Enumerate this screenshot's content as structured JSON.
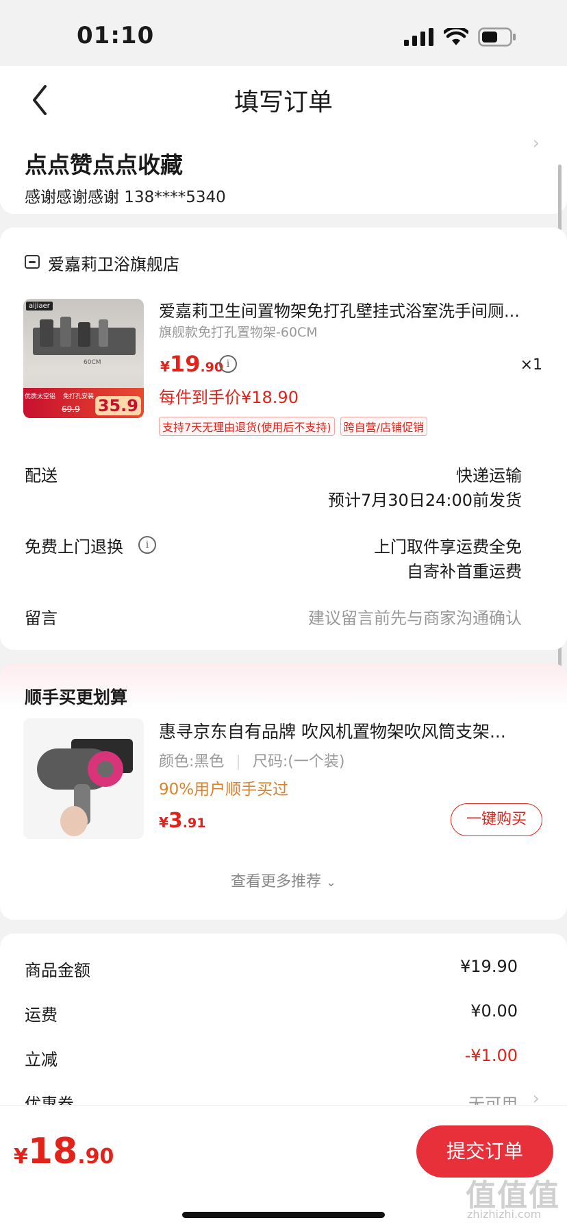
{
  "status_bar": {
    "time": "01:10"
  },
  "header": {
    "title": "填写订单"
  },
  "address": {
    "name": "点点赞点点收藏",
    "contact": "感谢感谢感谢  138****5340"
  },
  "store": {
    "name": "爱嘉莉卫浴旗舰店",
    "product": {
      "title": "爱嘉莉卫生间置物架免打孔壁挂式浴室洗手间厕...",
      "spec": "旗舰款免打孔置物架-60CM",
      "price_currency": "¥",
      "price_int": "19",
      "price_dec": ".90",
      "qty": "×1",
      "unit_price": "每件到手价¥18.90",
      "tags": [
        "支持7天无理由退货(使用后不支持)",
        "跨自营/店铺促销"
      ],
      "image_badge_price": "35.9",
      "image_badge_old": "69.9",
      "image_brand": "aijiaer",
      "image_tag1": "优质太空铝",
      "image_tag2": "免打孔安装",
      "image_dim": "60CM"
    },
    "rows": [
      {
        "label": "配送",
        "right1": "快递运输",
        "right2": "预计7月30日24:00前发货"
      },
      {
        "label": "免费上门退换",
        "right1": "上门取件享运费全免",
        "right2": "自寄补首重运费"
      },
      {
        "label": "留言",
        "placeholder": "建议留言前先与商家沟通确认"
      }
    ]
  },
  "recommend": {
    "title": "顺手买更划算",
    "product": {
      "title": "惠寻京东自有品牌 吹风机置物架吹风筒支架...",
      "color": "颜色:黑色",
      "size": "尺码:(一个装)",
      "bought": "90%用户顺手买过",
      "price_currency": "¥",
      "price_int": "3",
      "price_dec": ".91",
      "buy_label": "一键购买"
    },
    "more_label": "查看更多推荐"
  },
  "summary": {
    "rows": [
      {
        "label": "商品金额",
        "value": "¥19.90"
      },
      {
        "label": "运费",
        "value": "¥0.00"
      },
      {
        "label": "立减",
        "value": "-¥1.00"
      },
      {
        "label": "优惠券",
        "value": "无可用"
      }
    ]
  },
  "footer": {
    "total_currency": "¥",
    "total_int": "18",
    "total_dec": ".90",
    "submit_label": "提交订单"
  },
  "watermark": {
    "main": "值值值",
    "sub": "zhizhizhi.com"
  },
  "colors": {
    "accent": "#e2231a",
    "submit": "#e8303a",
    "bought": "#d9822b"
  }
}
